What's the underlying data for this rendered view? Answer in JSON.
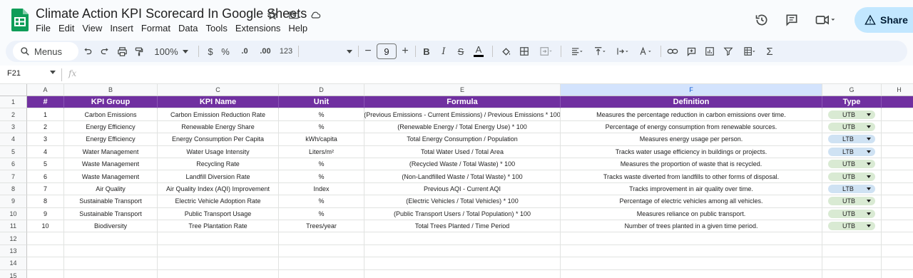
{
  "app": {
    "title": "Climate Action KPI Scorecard In Google Sheets",
    "menu": [
      "File",
      "Edit",
      "View",
      "Insert",
      "Format",
      "Data",
      "Tools",
      "Extensions",
      "Help"
    ],
    "share_label": "Share",
    "brand_color": "#0f9d58"
  },
  "toolbar": {
    "menus_label": "Menus",
    "zoom": "100%",
    "currency": "$",
    "percent": "%",
    "decrease_decimals": ".0",
    "increase_decimals": ".00",
    "number_format": "123",
    "font_size": "9",
    "minus": "−",
    "plus": "+",
    "bold": "B",
    "italic": "I",
    "strike": "S",
    "text_color": "A",
    "functions": "Σ"
  },
  "formula_bar": {
    "name_box": "F21",
    "fx": "fx"
  },
  "grid": {
    "columns": [
      "A",
      "B",
      "C",
      "D",
      "E",
      "F",
      "G",
      "H"
    ],
    "selected_column": "F",
    "row_numbers": [
      "1",
      "2",
      "3",
      "4",
      "5",
      "6",
      "7",
      "8",
      "9",
      "10",
      "11",
      "12",
      "13",
      "14",
      "15"
    ],
    "header_color": "#7030a0",
    "headers": [
      "#",
      "KPI Group",
      "KPI Name",
      "Unit",
      "Formula",
      "Definition",
      "Type"
    ],
    "rows": [
      [
        "1",
        "Carbon Emissions",
        "Carbon Emission Reduction Rate",
        "%",
        "(Previous Emissions - Current Emissions) / Previous Emissions * 100",
        "Measures the percentage reduction in carbon emissions over time.",
        "UTB"
      ],
      [
        "2",
        "Energy Efficiency",
        "Renewable Energy Share",
        "%",
        "(Renewable Energy / Total Energy Use) * 100",
        "Percentage of energy consumption from renewable sources.",
        "UTB"
      ],
      [
        "3",
        "Energy Efficiency",
        "Energy Consumption Per Capita",
        "kWh/capita",
        "Total Energy Consumption / Population",
        "Measures energy usage per person.",
        "LTB"
      ],
      [
        "4",
        "Water Management",
        "Water Usage Intensity",
        "Liters/m²",
        "Total Water Used / Total Area",
        "Tracks water usage efficiency in buildings or projects.",
        "LTB"
      ],
      [
        "5",
        "Waste Management",
        "Recycling Rate",
        "%",
        "(Recycled Waste / Total Waste) * 100",
        "Measures the proportion of waste that is recycled.",
        "UTB"
      ],
      [
        "6",
        "Waste Management",
        "Landfill Diversion Rate",
        "%",
        "(Non-Landfilled Waste / Total Waste) * 100",
        "Tracks waste diverted from landfills to other forms of disposal.",
        "UTB"
      ],
      [
        "7",
        "Air Quality",
        "Air Quality Index (AQI) Improvement",
        "Index",
        "Previous AQI - Current AQI",
        "Tracks improvement in air quality over time.",
        "LTB"
      ],
      [
        "8",
        "Sustainable Transport",
        "Electric Vehicle Adoption Rate",
        "%",
        "(Electric Vehicles / Total Vehicles) * 100",
        "Percentage of electric vehicles among all vehicles.",
        "UTB"
      ],
      [
        "9",
        "Sustainable Transport",
        "Public Transport Usage",
        "%",
        "(Public Transport Users / Total Population) * 100",
        "Measures reliance on public transport.",
        "UTB"
      ],
      [
        "10",
        "Biodiversity",
        "Tree Plantation Rate",
        "Trees/year",
        "Total Trees Planted / Time Period",
        "Number of trees planted in a given time period.",
        "UTB"
      ]
    ],
    "type_colors": {
      "UTB": "#d9ead3",
      "LTB": "#cfe2f3"
    }
  }
}
